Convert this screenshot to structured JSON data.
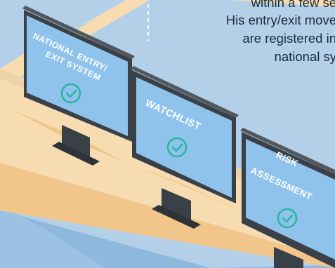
{
  "caption": {
    "lines": [
      "within  a few se",
      "His entry/exit move",
      "are registered in",
      "national sy"
    ]
  },
  "monitors": [
    {
      "label_lines": [
        "NATIONAL ENTRY/",
        "EXIT SYSTEM"
      ],
      "status_icon": "check-circle-icon"
    },
    {
      "label_lines": [
        "WATCHLIST"
      ],
      "status_icon": "check-circle-icon"
    },
    {
      "label_lines": [
        "RISK",
        "ASSESSMENT"
      ],
      "status_icon": "check-circle-icon"
    }
  ],
  "colors": {
    "wall": "#b3d0e8",
    "desk_top": "#f7dcb2",
    "desk_front": "#f2c58a",
    "floor_shadow": "#8fb8de",
    "screen": "#8fc3ec",
    "bezel": "#3a4047",
    "accent_teal": "#2bb5a5"
  }
}
